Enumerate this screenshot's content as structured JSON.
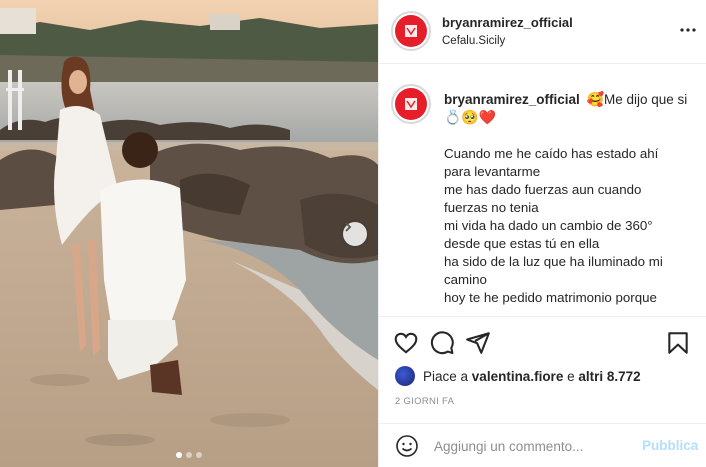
{
  "post": {
    "image": {
      "description_icon": "photo",
      "carousel_dots": 3,
      "carousel_active_index": 0
    },
    "header": {
      "username": "bryanramirez_official",
      "location": "Cefalu.Sicily",
      "more_icon": "ellipsis-icon"
    },
    "caption": {
      "username": "bryanramirez_official",
      "first_text": "Me dijo que si",
      "emoji_before": "🥰",
      "emoji_after": "💍🥺❤️",
      "lines": [
        "Cuando me he caído has estado ahí",
        "para levantarme",
        "me has dado fuerzas aun cuando",
        "fuerzas no tenia",
        "mi vida ha dado un cambio de 360°",
        "desde que estas tú en ella",
        "ha sido de la luz que ha iluminado mi",
        "camino",
        "hoy te he pedido matrimonio porque"
      ]
    },
    "likes": {
      "prefix": "Piace a",
      "user": "valentina.fiore",
      "middle": "e",
      "others": "altri 8.772"
    },
    "time_ago": "2 GIORNI FA",
    "comment": {
      "placeholder": "Aggiungi un commento...",
      "publish_label": "Pubblica"
    },
    "colors": {
      "brand_avatar": "#e61e2a",
      "publish_disabled": "#b2dffc",
      "muted": "#8e8e8e"
    }
  }
}
